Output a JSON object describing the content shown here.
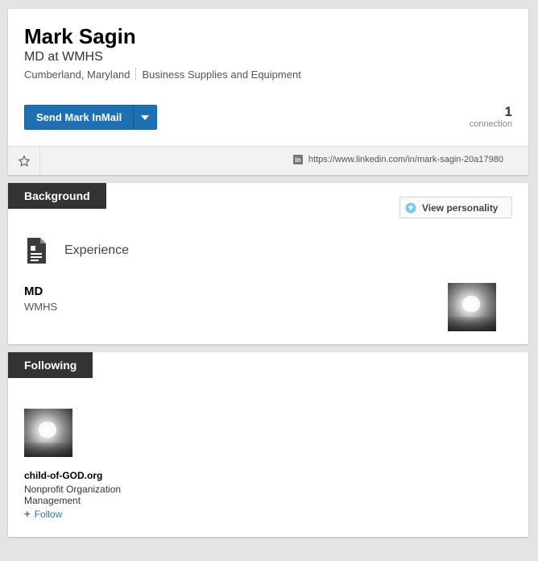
{
  "profile": {
    "name": "Mark Sagin",
    "headline": "MD at WMHS",
    "location": "Cumberland, Maryland",
    "industry": "Business Supplies and Equipment",
    "inmail_label": "Send Mark InMail",
    "connections_count": "1",
    "connections_label": "connection",
    "url": "https://www.linkedin.com/in/mark-sagin-20a17980",
    "url_badge": "in"
  },
  "background": {
    "tab_label": "Background",
    "view_personality_label": "View personality",
    "experience_title": "Experience",
    "position": {
      "title": "MD",
      "company": "WMHS"
    }
  },
  "following": {
    "tab_label": "Following",
    "items": [
      {
        "name": "child-of-GOD.org",
        "industry": "Nonprofit Organization Management",
        "follow_label": "Follow"
      }
    ]
  },
  "icons": [
    "chevron-down-icon",
    "star-icon",
    "linkedin-icon",
    "gem-icon",
    "document-icon",
    "plus-icon"
  ],
  "colors": {
    "accent": "#1f6fb2",
    "link": "#2c73b8",
    "tab_bg": "#333333",
    "page_bg": "#e4e4e4"
  }
}
